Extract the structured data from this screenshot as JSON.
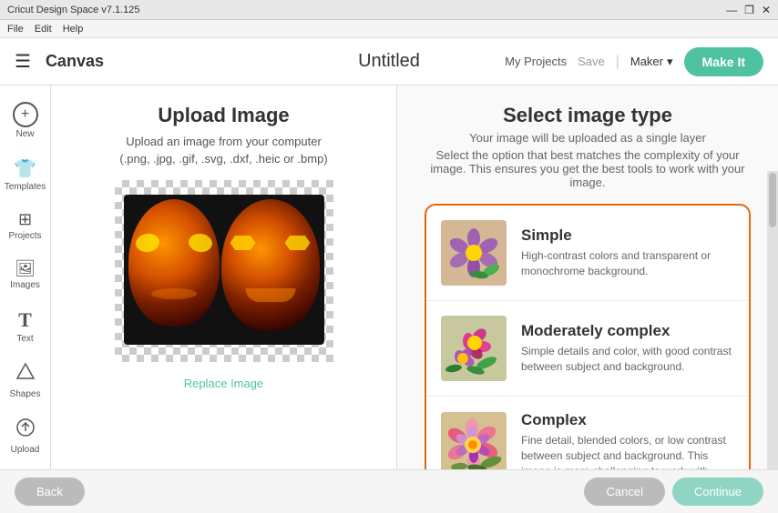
{
  "titlebar": {
    "title": "Cricut Design Space v7.1.125",
    "min": "—",
    "max": "❐",
    "close": "✕"
  },
  "menubar": {
    "file": "File",
    "edit": "Edit",
    "help": "Help"
  },
  "header": {
    "hamburger": "☰",
    "canvas_label": "Canvas",
    "title": "Untitled",
    "my_projects": "My Projects",
    "save": "Save",
    "divider": "|",
    "maker": "Maker",
    "make_it": "Make It"
  },
  "sidebar": {
    "items": [
      {
        "label": "New",
        "icon": "+"
      },
      {
        "label": "Templates",
        "icon": "👕"
      },
      {
        "label": "Projects",
        "icon": "⊞"
      },
      {
        "label": "Images",
        "icon": "🖼"
      },
      {
        "label": "Text",
        "icon": "T"
      },
      {
        "label": "Shapes",
        "icon": "⬟"
      },
      {
        "label": "Upload",
        "icon": "⬆"
      }
    ]
  },
  "upload_panel": {
    "title": "Upload Image",
    "description": "Upload an image from your computer",
    "formats": "(.png, .jpg, .gif, .svg, .dxf, .heic or .bmp)",
    "replace_link": "Replace Image"
  },
  "select_panel": {
    "title": "Select image type",
    "subtitle": "Your image will be uploaded as a single layer",
    "description": "Select the option that best matches the complexity of your image. This ensures you get the best tools to work with your image.",
    "types": [
      {
        "name": "Simple",
        "description": "High-contrast colors and transparent or monochrome background.",
        "thumb_class": "thumb-simple"
      },
      {
        "name": "Moderately complex",
        "description": "Simple details and color, with good contrast between subject and background.",
        "thumb_class": "thumb-moderate"
      },
      {
        "name": "Complex",
        "description": "Fine detail, blended colors, or low contrast between subject and background. This image is more challenging to work with.",
        "thumb_class": "thumb-complex"
      }
    ]
  },
  "bottom_bar": {
    "back": "Back",
    "cancel": "Cancel",
    "continue": "Continue"
  }
}
